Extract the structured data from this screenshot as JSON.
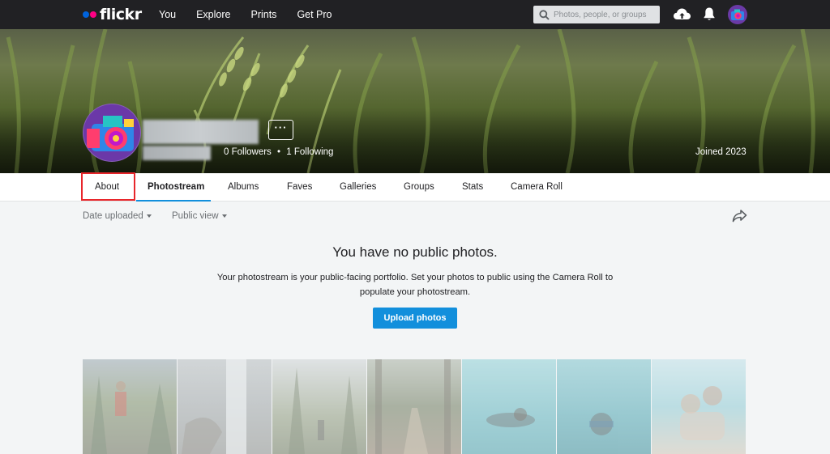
{
  "topnav": {
    "logo": "flickr",
    "links": [
      "You",
      "Explore",
      "Prints",
      "Get Pro"
    ],
    "search_placeholder": "Photos, people, or groups",
    "icons": [
      "upload-cloud-icon",
      "bell-icon",
      "user-avatar-icon"
    ]
  },
  "profile": {
    "followers": "0 Followers",
    "separator": "•",
    "following": "1 Following",
    "joined": "Joined 2023",
    "more_label": "···"
  },
  "tabs": [
    "About",
    "Photostream",
    "Albums",
    "Faves",
    "Galleries",
    "Groups",
    "Stats",
    "Camera Roll"
  ],
  "active_tab": "Photostream",
  "highlighted_tab": "About",
  "filters": {
    "sort": "Date uploaded",
    "view": "Public view"
  },
  "empty": {
    "title": "You have no public photos.",
    "description": "Your photostream is your public-facing portfolio. Set your photos to public using the Camera Roll to populate your photostream.",
    "button": "Upload photos"
  },
  "colors": {
    "accent": "#128fdc",
    "highlight": "#e8262b",
    "nav_bg": "#212124"
  }
}
